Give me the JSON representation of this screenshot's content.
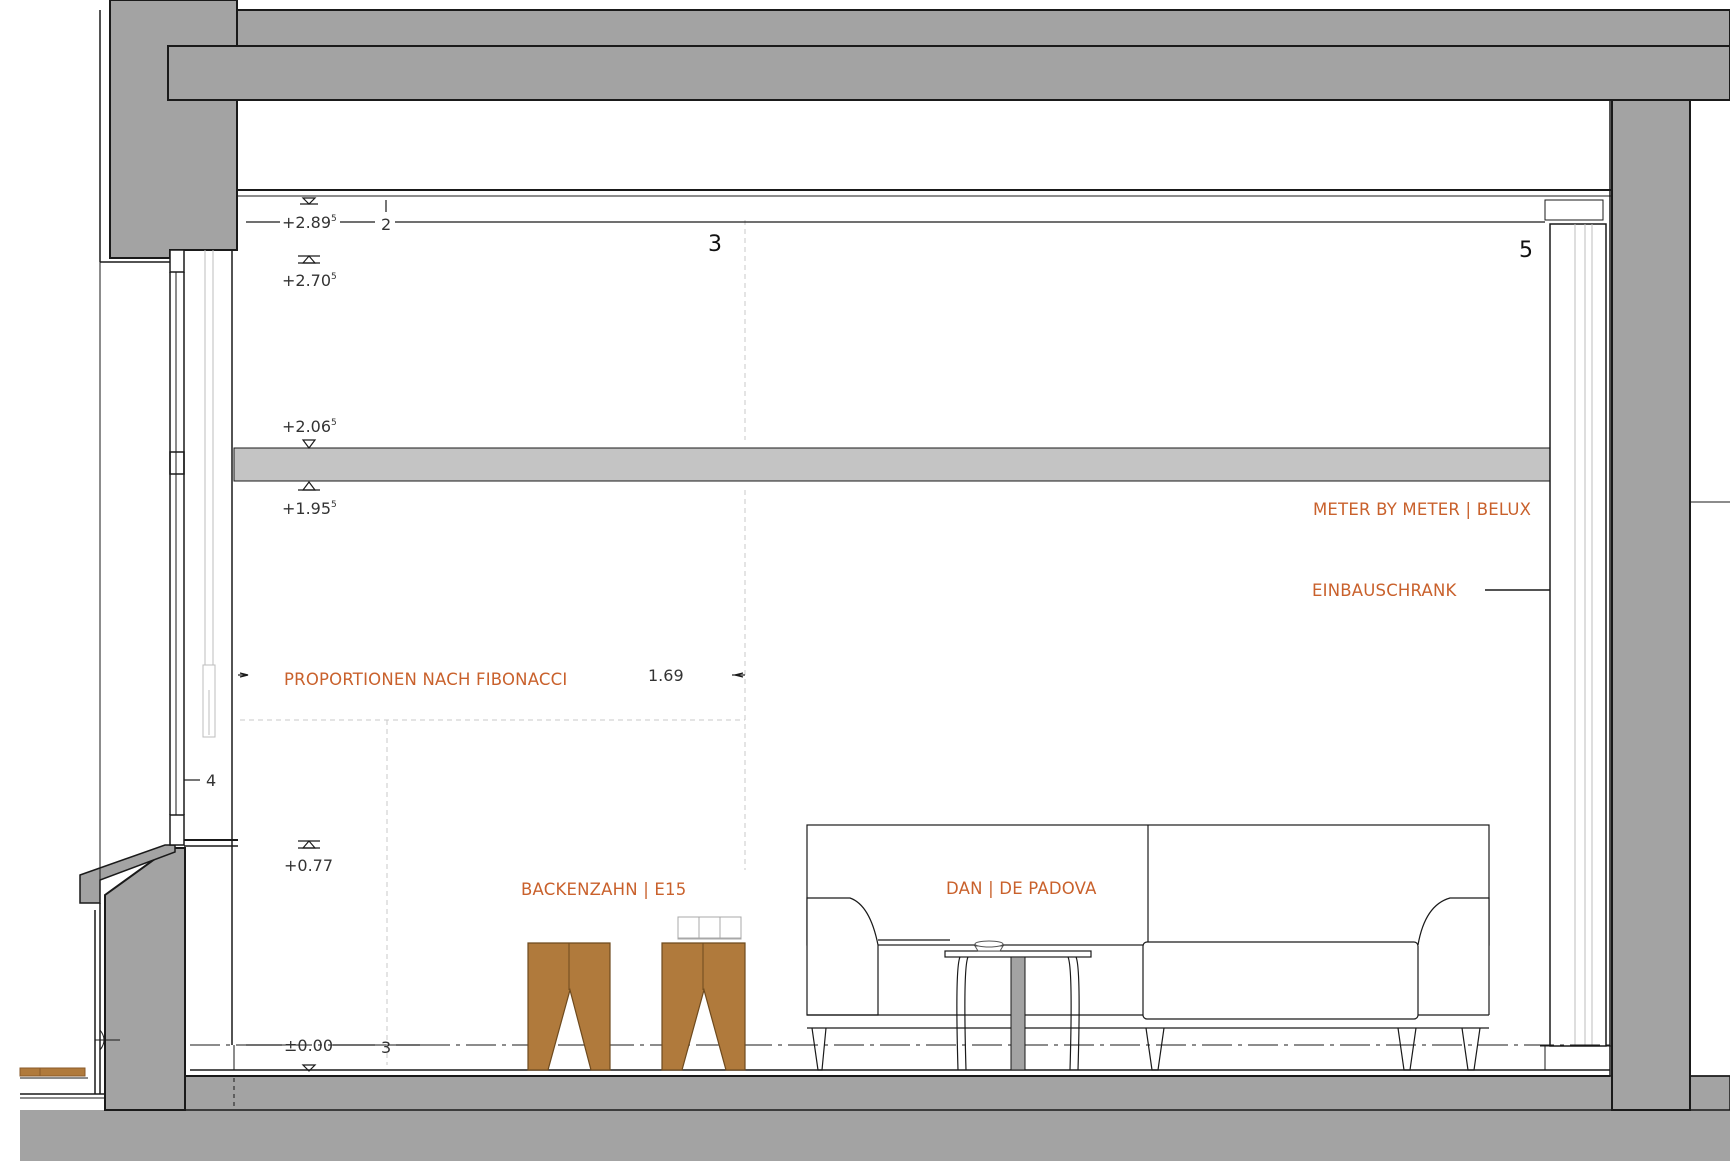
{
  "colors": {
    "wall": "#a3a3a3",
    "beam": "#c4c4c4",
    "label": "#c9612c",
    "wood": "#b07a3c",
    "wood_dark": "#8a5a28",
    "line": "#1a1a1a"
  },
  "levels": [
    {
      "main": "+2.89",
      "sup": "5"
    },
    {
      "main": "+2.70",
      "sup": "5"
    },
    {
      "main": "+2.06",
      "sup": "5"
    },
    {
      "main": "+1.95",
      "sup": "5"
    },
    {
      "main": "+0.77",
      "sup": ""
    },
    {
      "main": "±0.00",
      "sup": ""
    }
  ],
  "markers": {
    "top_small": "2",
    "big_a": "3",
    "big_b": "5",
    "side": "4",
    "bottom_small": "3"
  },
  "dimension": "1.69",
  "labels": {
    "meter": "METER BY METER | BELUX",
    "einbau": "EINBAUSCHRANK",
    "fibonacci": "PROPORTIONEN NACH FIBONACCI",
    "backenzahn": "BACKENZAHN | E15",
    "dan": "DAN | DE PADOVA"
  }
}
